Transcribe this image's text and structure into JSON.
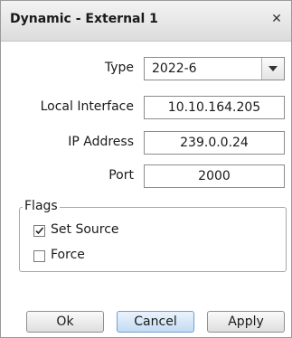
{
  "dialog": {
    "title": "Dynamic - External 1",
    "close_icon": "close-icon"
  },
  "fields": {
    "type": {
      "label": "Type",
      "value": "2022-6"
    },
    "local_interface": {
      "label": "Local Interface",
      "value": "10.10.164.205"
    },
    "ip_address": {
      "label": "IP Address",
      "value": "239.0.0.24"
    },
    "port": {
      "label": "Port",
      "value": "2000"
    }
  },
  "flags": {
    "legend": "Flags",
    "set_source": {
      "label": "Set Source",
      "checked": true
    },
    "force": {
      "label": "Force",
      "checked": false
    }
  },
  "buttons": {
    "ok": "Ok",
    "cancel": "Cancel",
    "apply": "Apply"
  }
}
